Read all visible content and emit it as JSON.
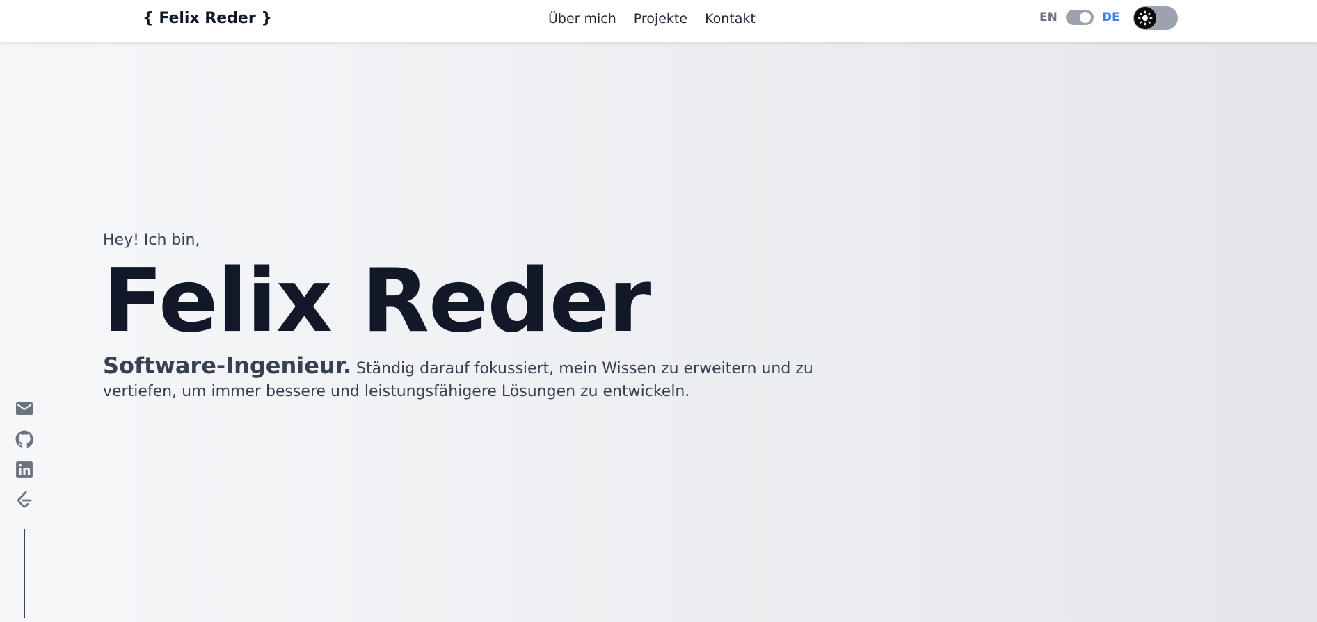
{
  "nav": {
    "logo": "{ Felix Reder }",
    "links": [
      "Über mich",
      "Projekte",
      "Kontakt"
    ],
    "lang_en": "EN",
    "lang_de": "DE",
    "active_language": "DE",
    "theme": "light"
  },
  "hero": {
    "greeting": "Hey! Ich bin,",
    "name": "Felix Reder",
    "role": "Software-Ingenieur.",
    "description": "Ständig darauf fokussiert, mein Wissen zu erweitern und zu vertiefen, um immer bessere und leistungsfähigere Lösungen zu entwickeln."
  },
  "social": {
    "icons": [
      "mail-icon",
      "github-icon",
      "linkedin-icon",
      "leetcode-icon"
    ]
  },
  "colors": {
    "accent": "#3b82f6",
    "text_dark": "#111827",
    "text_body": "#374151",
    "icon_gray": "#6b7280"
  }
}
